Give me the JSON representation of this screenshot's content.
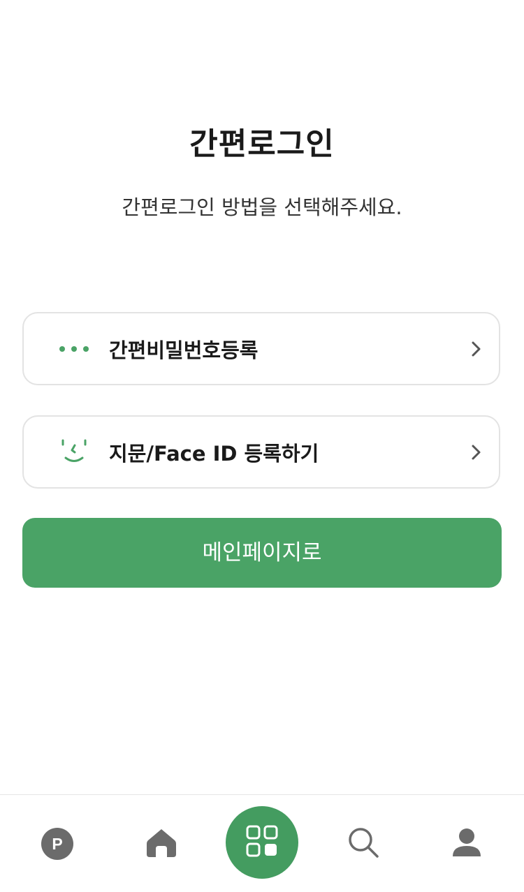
{
  "header": {
    "title": "간편로그인",
    "subtitle": "간편로그인 방법을 선택해주세요."
  },
  "options": [
    {
      "label": "간편비밀번호등록",
      "icon": "password-dots-icon"
    },
    {
      "label": "지문/Face ID 등록하기",
      "icon": "face-id-icon"
    }
  ],
  "primary_button": {
    "label": "메인페이지로"
  },
  "tabbar": {
    "points_badge": "P",
    "items": [
      {
        "icon": "points-icon"
      },
      {
        "icon": "home-icon"
      },
      {
        "icon": "menu-grid-icon"
      },
      {
        "icon": "search-icon"
      },
      {
        "icon": "profile-icon"
      }
    ]
  },
  "colors": {
    "accent": "#4aa366",
    "icon_gray": "#6b6b6b",
    "text": "#1a1a1a"
  }
}
